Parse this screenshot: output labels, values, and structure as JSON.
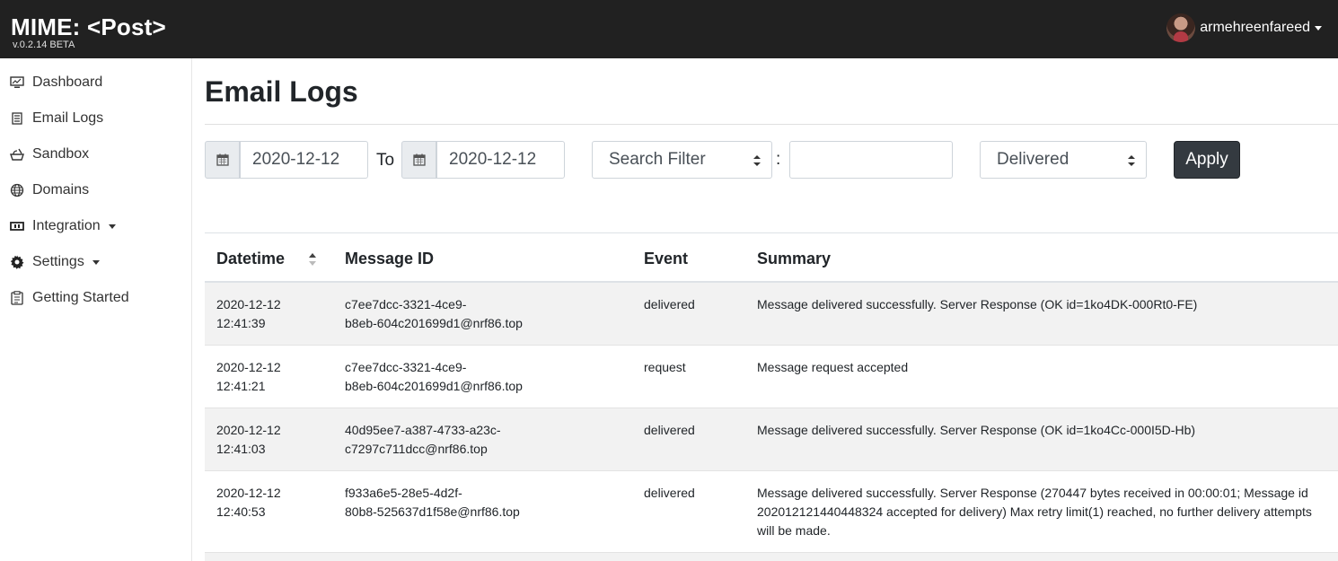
{
  "app": {
    "brand": "MIME: <Post>",
    "version": "v.0.2.14 BETA",
    "user": "armehreenfareed"
  },
  "sidebar": {
    "items": [
      {
        "label": "Dashboard",
        "icon": "monitor-icon"
      },
      {
        "label": "Email Logs",
        "icon": "list-icon"
      },
      {
        "label": "Sandbox",
        "icon": "sandbox-icon"
      },
      {
        "label": "Domains",
        "icon": "globe-icon"
      },
      {
        "label": "Integration",
        "icon": "plug-icon",
        "dropdown": true
      },
      {
        "label": "Settings",
        "icon": "gear-icon",
        "dropdown": true
      },
      {
        "label": "Getting Started",
        "icon": "clipboard-icon"
      }
    ]
  },
  "page": {
    "title": "Email Logs"
  },
  "filters": {
    "date_from": "2020-12-12",
    "to_label": "To",
    "date_to": "2020-12-12",
    "search_filter": "Search Filter",
    "separator": ":",
    "search_value": "",
    "status": "Delivered",
    "apply_label": "Apply"
  },
  "table": {
    "headers": [
      "Datetime",
      "Message ID",
      "Event",
      "Summary"
    ],
    "rows": [
      {
        "date": "2020-12-12",
        "time": "12:41:39",
        "id_line1": "c7ee7dcc-3321-4ce9-",
        "id_line2": "b8eb-604c201699d1@nrf86.top",
        "event": "delivered",
        "summary": "Message delivered successfully. Server Response (OK id=1ko4DK-000Rt0-FE)"
      },
      {
        "date": "2020-12-12",
        "time": "12:41:21",
        "id_line1": "c7ee7dcc-3321-4ce9-",
        "id_line2": "b8eb-604c201699d1@nrf86.top",
        "event": "request",
        "summary": "Message request accepted"
      },
      {
        "date": "2020-12-12",
        "time": "12:41:03",
        "id_line1": "40d95ee7-a387-4733-a23c-",
        "id_line2": "c7297c711dcc@nrf86.top",
        "event": "delivered",
        "summary": "Message delivered successfully. Server Response (OK id=1ko4Cc-000I5D-Hb)"
      },
      {
        "date": "2020-12-12",
        "time": "12:40:53",
        "id_line1": "f933a6e5-28e5-4d2f-",
        "id_line2": "80b8-525637d1f58e@nrf86.top",
        "event": "delivered",
        "summary": "Message delivered successfully. Server Response (270447 bytes received in 00:00:01; Message id 202012121440448324 accepted for delivery) Max retry limit(1) reached, no further delivery attempts will be made."
      }
    ]
  }
}
